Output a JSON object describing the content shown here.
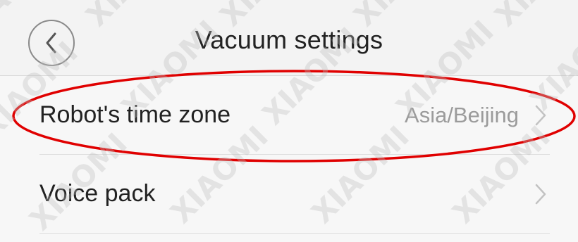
{
  "header": {
    "title": "Vacuum settings",
    "back_icon": "chevron-left-icon"
  },
  "settings": [
    {
      "label": "Robot's time zone",
      "value": "Asia/Beijing",
      "icon": "chevron-right-icon"
    },
    {
      "label": "Voice pack",
      "value": "",
      "icon": "chevron-right-icon"
    }
  ],
  "annotation": {
    "highlight_color": "#e00000",
    "shape": "ellipse"
  },
  "watermark": {
    "text": "XIAOMI"
  },
  "colors": {
    "header_bg": "#f3f3f3",
    "page_bg": "#f7f7f7",
    "value_text": "#9b9b9b"
  }
}
